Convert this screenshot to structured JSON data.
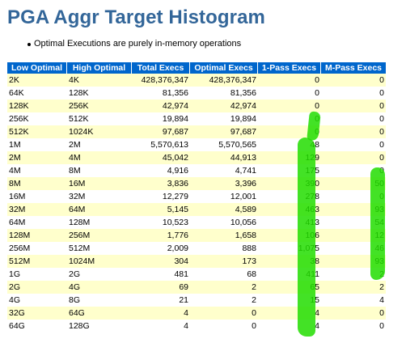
{
  "page": {
    "title": "PGA Aggr Target Histogram",
    "bullets": [
      "Optimal Executions are purely in-memory operations"
    ]
  },
  "table": {
    "headers": [
      "Low Optimal",
      "High Optimal",
      "Total Execs",
      "Optimal Execs",
      "1-Pass Execs",
      "M-Pass Execs"
    ],
    "rows": [
      [
        "2K",
        "4K",
        "428,376,347",
        "428,376,347",
        "0",
        "0"
      ],
      [
        "64K",
        "128K",
        "81,356",
        "81,356",
        "0",
        "0"
      ],
      [
        "128K",
        "256K",
        "42,974",
        "42,974",
        "0",
        "0"
      ],
      [
        "256K",
        "512K",
        "19,894",
        "19,894",
        "0",
        "0"
      ],
      [
        "512K",
        "1024K",
        "97,687",
        "97,687",
        "0",
        "0"
      ],
      [
        "1M",
        "2M",
        "5,570,613",
        "5,570,565",
        "48",
        "0"
      ],
      [
        "2M",
        "4M",
        "45,042",
        "44,913",
        "129",
        "0"
      ],
      [
        "4M",
        "8M",
        "4,916",
        "4,741",
        "175",
        "0"
      ],
      [
        "8M",
        "16M",
        "3,836",
        "3,396",
        "390",
        "50"
      ],
      [
        "16M",
        "32M",
        "12,279",
        "12,001",
        "278",
        "0"
      ],
      [
        "32M",
        "64M",
        "5,145",
        "4,589",
        "463",
        "93"
      ],
      [
        "64M",
        "128M",
        "10,523",
        "10,056",
        "413",
        "54"
      ],
      [
        "128M",
        "256M",
        "1,776",
        "1,658",
        "106",
        "12"
      ],
      [
        "256M",
        "512M",
        "2,009",
        "888",
        "1,075",
        "46"
      ],
      [
        "512M",
        "1024M",
        "304",
        "173",
        "38",
        "93"
      ],
      [
        "1G",
        "2G",
        "481",
        "68",
        "411",
        "2"
      ],
      [
        "2G",
        "4G",
        "69",
        "2",
        "65",
        "2"
      ],
      [
        "4G",
        "8G",
        "21",
        "2",
        "15",
        "4"
      ],
      [
        "32G",
        "64G",
        "4",
        "0",
        "4",
        "0"
      ],
      [
        "64G",
        "128G",
        "4",
        "0",
        "4",
        "0"
      ]
    ]
  },
  "colors": {
    "title": "#336699",
    "header_bg": "#0066cc",
    "header_text": "#ffffff",
    "row_alt": "#ffffcc",
    "highlight": "#22dd00"
  }
}
